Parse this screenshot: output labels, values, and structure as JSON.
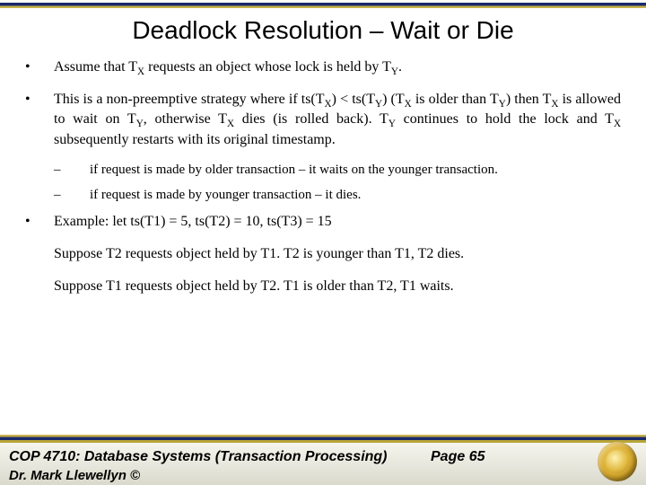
{
  "title": "Deadlock Resolution – Wait or Die",
  "bullets": {
    "b1_pre": "Assume that T",
    "b1_mid": " requests an object whose lock is held by T",
    "b1_end": ".",
    "b2_a": "This is a non-preemptive strategy where if ts(T",
    "b2_b": ") < ts(T",
    "b2_c": ") (T",
    "b2_d": " is older than T",
    "b2_e": ") then T",
    "b2_f": " is allowed to wait on T",
    "b2_g": ", otherwise T",
    "b2_h": " dies (is rolled back).  T",
    "b2_i": " continues to hold the lock and T",
    "b2_j": " subsequently restarts with its original timestamp.",
    "sub1": "if request is made by older transaction – it waits on the younger transaction.",
    "sub2": "if request is made by younger transaction – it dies.",
    "ex_intro": "Example:  let ts(T1) = 5, ts(T2) = 10, ts(T3) = 15",
    "ex_line1": "Suppose T2 requests object held by T1.  T2 is younger than T1, T2 dies.",
    "ex_line2": "Suppose T1 requests object held by T2.   T1 is older than T2, T1 waits."
  },
  "sub_x": "X",
  "sub_y": "Y",
  "footer": {
    "course": "COP 4710: Database Systems  (Transaction Processing)",
    "page": "Page 65",
    "author": "Dr. Mark Llewellyn ©"
  }
}
